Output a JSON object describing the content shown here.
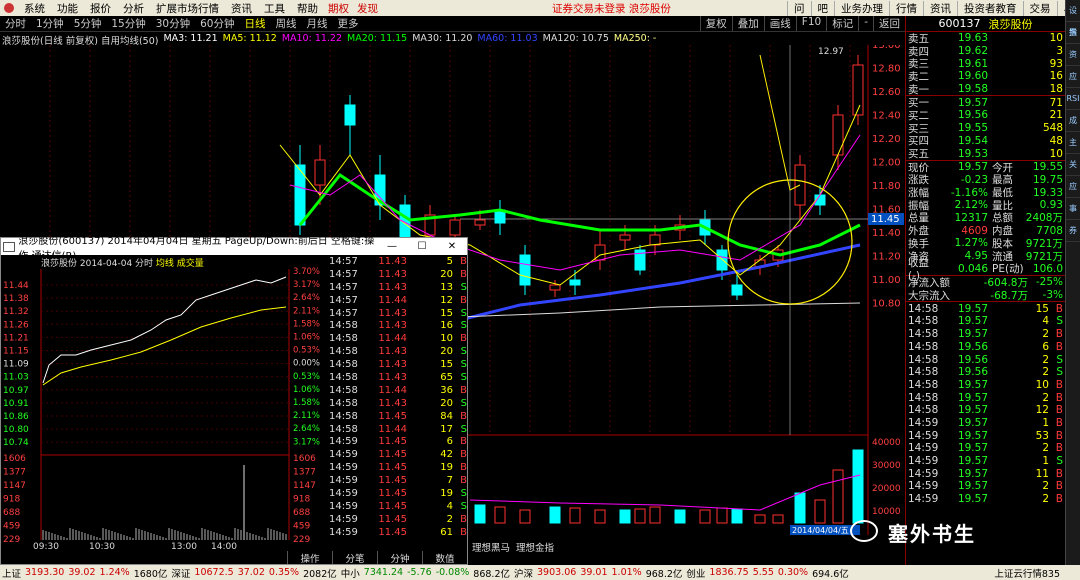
{
  "menubar": {
    "items": [
      "系统",
      "功能",
      "报价",
      "分析",
      "扩展市场行情",
      "资讯",
      "工具",
      "帮助"
    ],
    "tabs": [
      "期权",
      "发现"
    ],
    "center_text": "证券交易未登录  浪莎股份",
    "right_buttons": [
      "问",
      "吧",
      "业务办理",
      "行情",
      "资讯",
      "投资者教育",
      "交易",
      "易"
    ]
  },
  "timeframe": {
    "items": [
      "分时",
      "1分钟",
      "5分钟",
      "15分钟",
      "30分钟",
      "60分钟",
      "日线",
      "周线",
      "月线",
      "更多"
    ],
    "active": "日线",
    "right_buttons": [
      "复权",
      "叠加",
      "画线",
      "F10",
      "标记",
      "-",
      "返回"
    ]
  },
  "ma_bar": {
    "title": "浪莎股份(日线 前复权) 自用均线(50)",
    "items": [
      {
        "label": "MA3: 11.21",
        "color": "#ffffff"
      },
      {
        "label": "MA5: 11.12",
        "color": "#ffff00"
      },
      {
        "label": "MA10: 11.22",
        "color": "#ff00ff"
      },
      {
        "label": "MA20: 11.15",
        "color": "#00ff00"
      },
      {
        "label": "MA30: 11.20",
        "color": "#dddddd"
      },
      {
        "label": "MA60: 11.03",
        "color": "#3344ff"
      },
      {
        "label": "MA120: 10.75",
        "color": "#dddddd"
      },
      {
        "label": "MA250: -",
        "color": "#ffff88"
      }
    ]
  },
  "chart_data": {
    "type": "candlestick",
    "price_axis": [
      "13.00",
      "12.80",
      "12.60",
      "12.40",
      "12.20",
      "12.00",
      "11.80",
      "11.60",
      "11.40",
      "11.20",
      "11.00",
      "10.80"
    ],
    "current_price_tag": "11.45",
    "high_marker": "12.97",
    "volume_axis": [
      "40000",
      "30000",
      "20000",
      "10000"
    ],
    "date_label": "2014/04/04/五",
    "colors": {
      "up": "#ff3030",
      "down": "#00ffff"
    }
  },
  "quote": {
    "code": "600137",
    "name": "浪莎股份",
    "sell": [
      {
        "label": "卖五",
        "price": "19.63",
        "vol": "10"
      },
      {
        "label": "卖四",
        "price": "19.62",
        "vol": "3"
      },
      {
        "label": "卖三",
        "price": "19.61",
        "vol": "93"
      },
      {
        "label": "卖二",
        "price": "19.60",
        "vol": "16"
      },
      {
        "label": "卖一",
        "price": "19.58",
        "vol": "18"
      }
    ],
    "buy": [
      {
        "label": "买一",
        "price": "19.57",
        "vol": "71"
      },
      {
        "label": "买二",
        "price": "19.56",
        "vol": "21"
      },
      {
        "label": "买三",
        "price": "19.55",
        "vol": "548"
      },
      {
        "label": "买四",
        "price": "19.54",
        "vol": "48"
      },
      {
        "label": "买五",
        "price": "19.53",
        "vol": "10"
      }
    ],
    "stats": [
      {
        "l1": "现价",
        "v1": "19.57",
        "l2": "今开",
        "v2": "19.55"
      },
      {
        "l1": "涨跌",
        "v1": "-0.23",
        "l2": "最高",
        "v2": "19.75"
      },
      {
        "l1": "涨幅",
        "v1": "-1.16%",
        "l2": "最低",
        "v2": "19.33"
      },
      {
        "l1": "振幅",
        "v1": "2.12%",
        "l2": "量比",
        "v2": "0.93"
      },
      {
        "l1": "总量",
        "v1": "12317",
        "l2": "总额",
        "v2": "2408万"
      },
      {
        "l1": "外盘",
        "v1": "4609",
        "l2": "内盘",
        "v2": "7708"
      },
      {
        "l1": "换手",
        "v1": "1.27%",
        "l2": "股本",
        "v2": "9721万"
      },
      {
        "l1": "净资",
        "v1": "4.95",
        "l2": "流通",
        "v2": "9721万"
      },
      {
        "l1": "收益(-)",
        "v1": "0.046",
        "l2": "PE(动)",
        "v2": "106.0"
      }
    ],
    "flow": [
      {
        "label": "净流入额",
        "value": "-604.8万",
        "pct": "-25%"
      },
      {
        "label": "大宗流入",
        "value": "-68.7万",
        "pct": "-3%"
      }
    ],
    "ticks": [
      [
        "14:58",
        "19.57",
        "15",
        "B"
      ],
      [
        "14:58",
        "19.57",
        "4",
        "S"
      ],
      [
        "14:58",
        "19.57",
        "2",
        "B"
      ],
      [
        "14:58",
        "19.56",
        "6",
        "B"
      ],
      [
        "14:58",
        "19.56",
        "2",
        "S"
      ],
      [
        "14:58",
        "19.56",
        "2",
        "S"
      ],
      [
        "14:58",
        "19.57",
        "10",
        "B"
      ],
      [
        "14:58",
        "19.57",
        "2",
        "B"
      ],
      [
        "14:58",
        "19.57",
        "12",
        "B"
      ],
      [
        "14:59",
        "19.57",
        "1",
        "B"
      ],
      [
        "14:59",
        "19.57",
        "53",
        "B"
      ],
      [
        "14:59",
        "19.57",
        "2",
        "B"
      ],
      [
        "14:59",
        "19.57",
        "1",
        "S"
      ],
      [
        "14:59",
        "19.57",
        "11",
        "B"
      ],
      [
        "14:59",
        "19.57",
        "2",
        "B"
      ],
      [
        "14:59",
        "19.57",
        "2",
        "B"
      ]
    ]
  },
  "popup": {
    "title": "浪莎股份(600137) 2014年04月04日 星期五 PageUp/Down:前后日 空格键:操作 通达信(R)",
    "legend": {
      "name": "浪莎股份",
      "date": "2014-04-04",
      "tf": "分时",
      "ma": "均线",
      "vol": "成交量"
    },
    "price_labels": [
      "11.44",
      "11.38",
      "11.32",
      "11.26",
      "11.21",
      "11.15",
      "11.09",
      "11.03",
      "10.97",
      "10.91",
      "10.86",
      "10.80",
      "10.74"
    ],
    "pct_labels": [
      "3.70%",
      "3.17%",
      "2.64%",
      "2.11%",
      "1.58%",
      "1.06%",
      "0.53%",
      "0.00%",
      "0.53%",
      "1.06%",
      "1.58%",
      "2.11%",
      "2.64%",
      "3.17%"
    ],
    "vol_labels": [
      "1606",
      "1377",
      "1147",
      "918",
      "688",
      "459",
      "229"
    ],
    "time_labels": [
      "09:30",
      "10:30",
      "13:00",
      "14:00"
    ],
    "ticks": [
      [
        "14:57",
        "11.43",
        "5",
        "B"
      ],
      [
        "14:57",
        "11.43",
        "20",
        "B"
      ],
      [
        "14:57",
        "11.43",
        "13",
        "S"
      ],
      [
        "14:57",
        "11.44",
        "12",
        "B"
      ],
      [
        "14:57",
        "11.43",
        "15",
        "S"
      ],
      [
        "14:58",
        "11.43",
        "16",
        "S"
      ],
      [
        "14:58",
        "11.44",
        "10",
        "B"
      ],
      [
        "14:58",
        "11.43",
        "20",
        "S"
      ],
      [
        "14:58",
        "11.43",
        "15",
        "S"
      ],
      [
        "14:58",
        "11.43",
        "65",
        "S"
      ],
      [
        "14:58",
        "11.44",
        "36",
        "B"
      ],
      [
        "14:58",
        "11.43",
        "20",
        "S"
      ],
      [
        "14:58",
        "11.45",
        "84",
        "B"
      ],
      [
        "14:58",
        "11.44",
        "17",
        "S"
      ],
      [
        "14:59",
        "11.45",
        "6",
        "B"
      ],
      [
        "14:59",
        "11.45",
        "42",
        "B"
      ],
      [
        "14:59",
        "11.45",
        "19",
        "B"
      ],
      [
        "14:59",
        "11.45",
        "7",
        "B"
      ],
      [
        "14:59",
        "11.45",
        "19",
        "S"
      ],
      [
        "14:59",
        "11.45",
        "4",
        "S"
      ],
      [
        "14:59",
        "11.45",
        "2",
        "B"
      ],
      [
        "14:59",
        "11.45",
        "61",
        "B"
      ]
    ],
    "bottom_tabs": [
      "操作",
      "分笔",
      "分钟",
      "数值"
    ]
  },
  "mid_labels": [
    "理想黑马",
    "理想金指"
  ],
  "right_strip": [
    "设置",
    "指",
    "资",
    "应",
    "RSI",
    "成",
    "主",
    "关",
    "应",
    "事",
    "券"
  ],
  "bottombar": {
    "items": [
      {
        "n": "上证",
        "v": "3193.30",
        "c": "39.02",
        "p": "1.24%",
        "a": "1680亿"
      },
      {
        "n": "深证",
        "v": "10672.5",
        "c": "37.02",
        "p": "0.35%",
        "a": "2082亿"
      },
      {
        "n": "中小",
        "v": "7341.24",
        "c": "-5.76",
        "p": "-0.08%",
        "a": "868.2亿"
      },
      {
        "n": "沪深",
        "v": "3903.06",
        "c": "39.01",
        "p": "1.01%",
        "a": "968.2亿"
      },
      {
        "n": "创业",
        "v": "1836.75",
        "c": "5.55",
        "p": "0.30%",
        "a": "694.6亿"
      }
    ],
    "right": "上证云行情835"
  },
  "watermark": {
    "text": "塞外书生 "
  }
}
